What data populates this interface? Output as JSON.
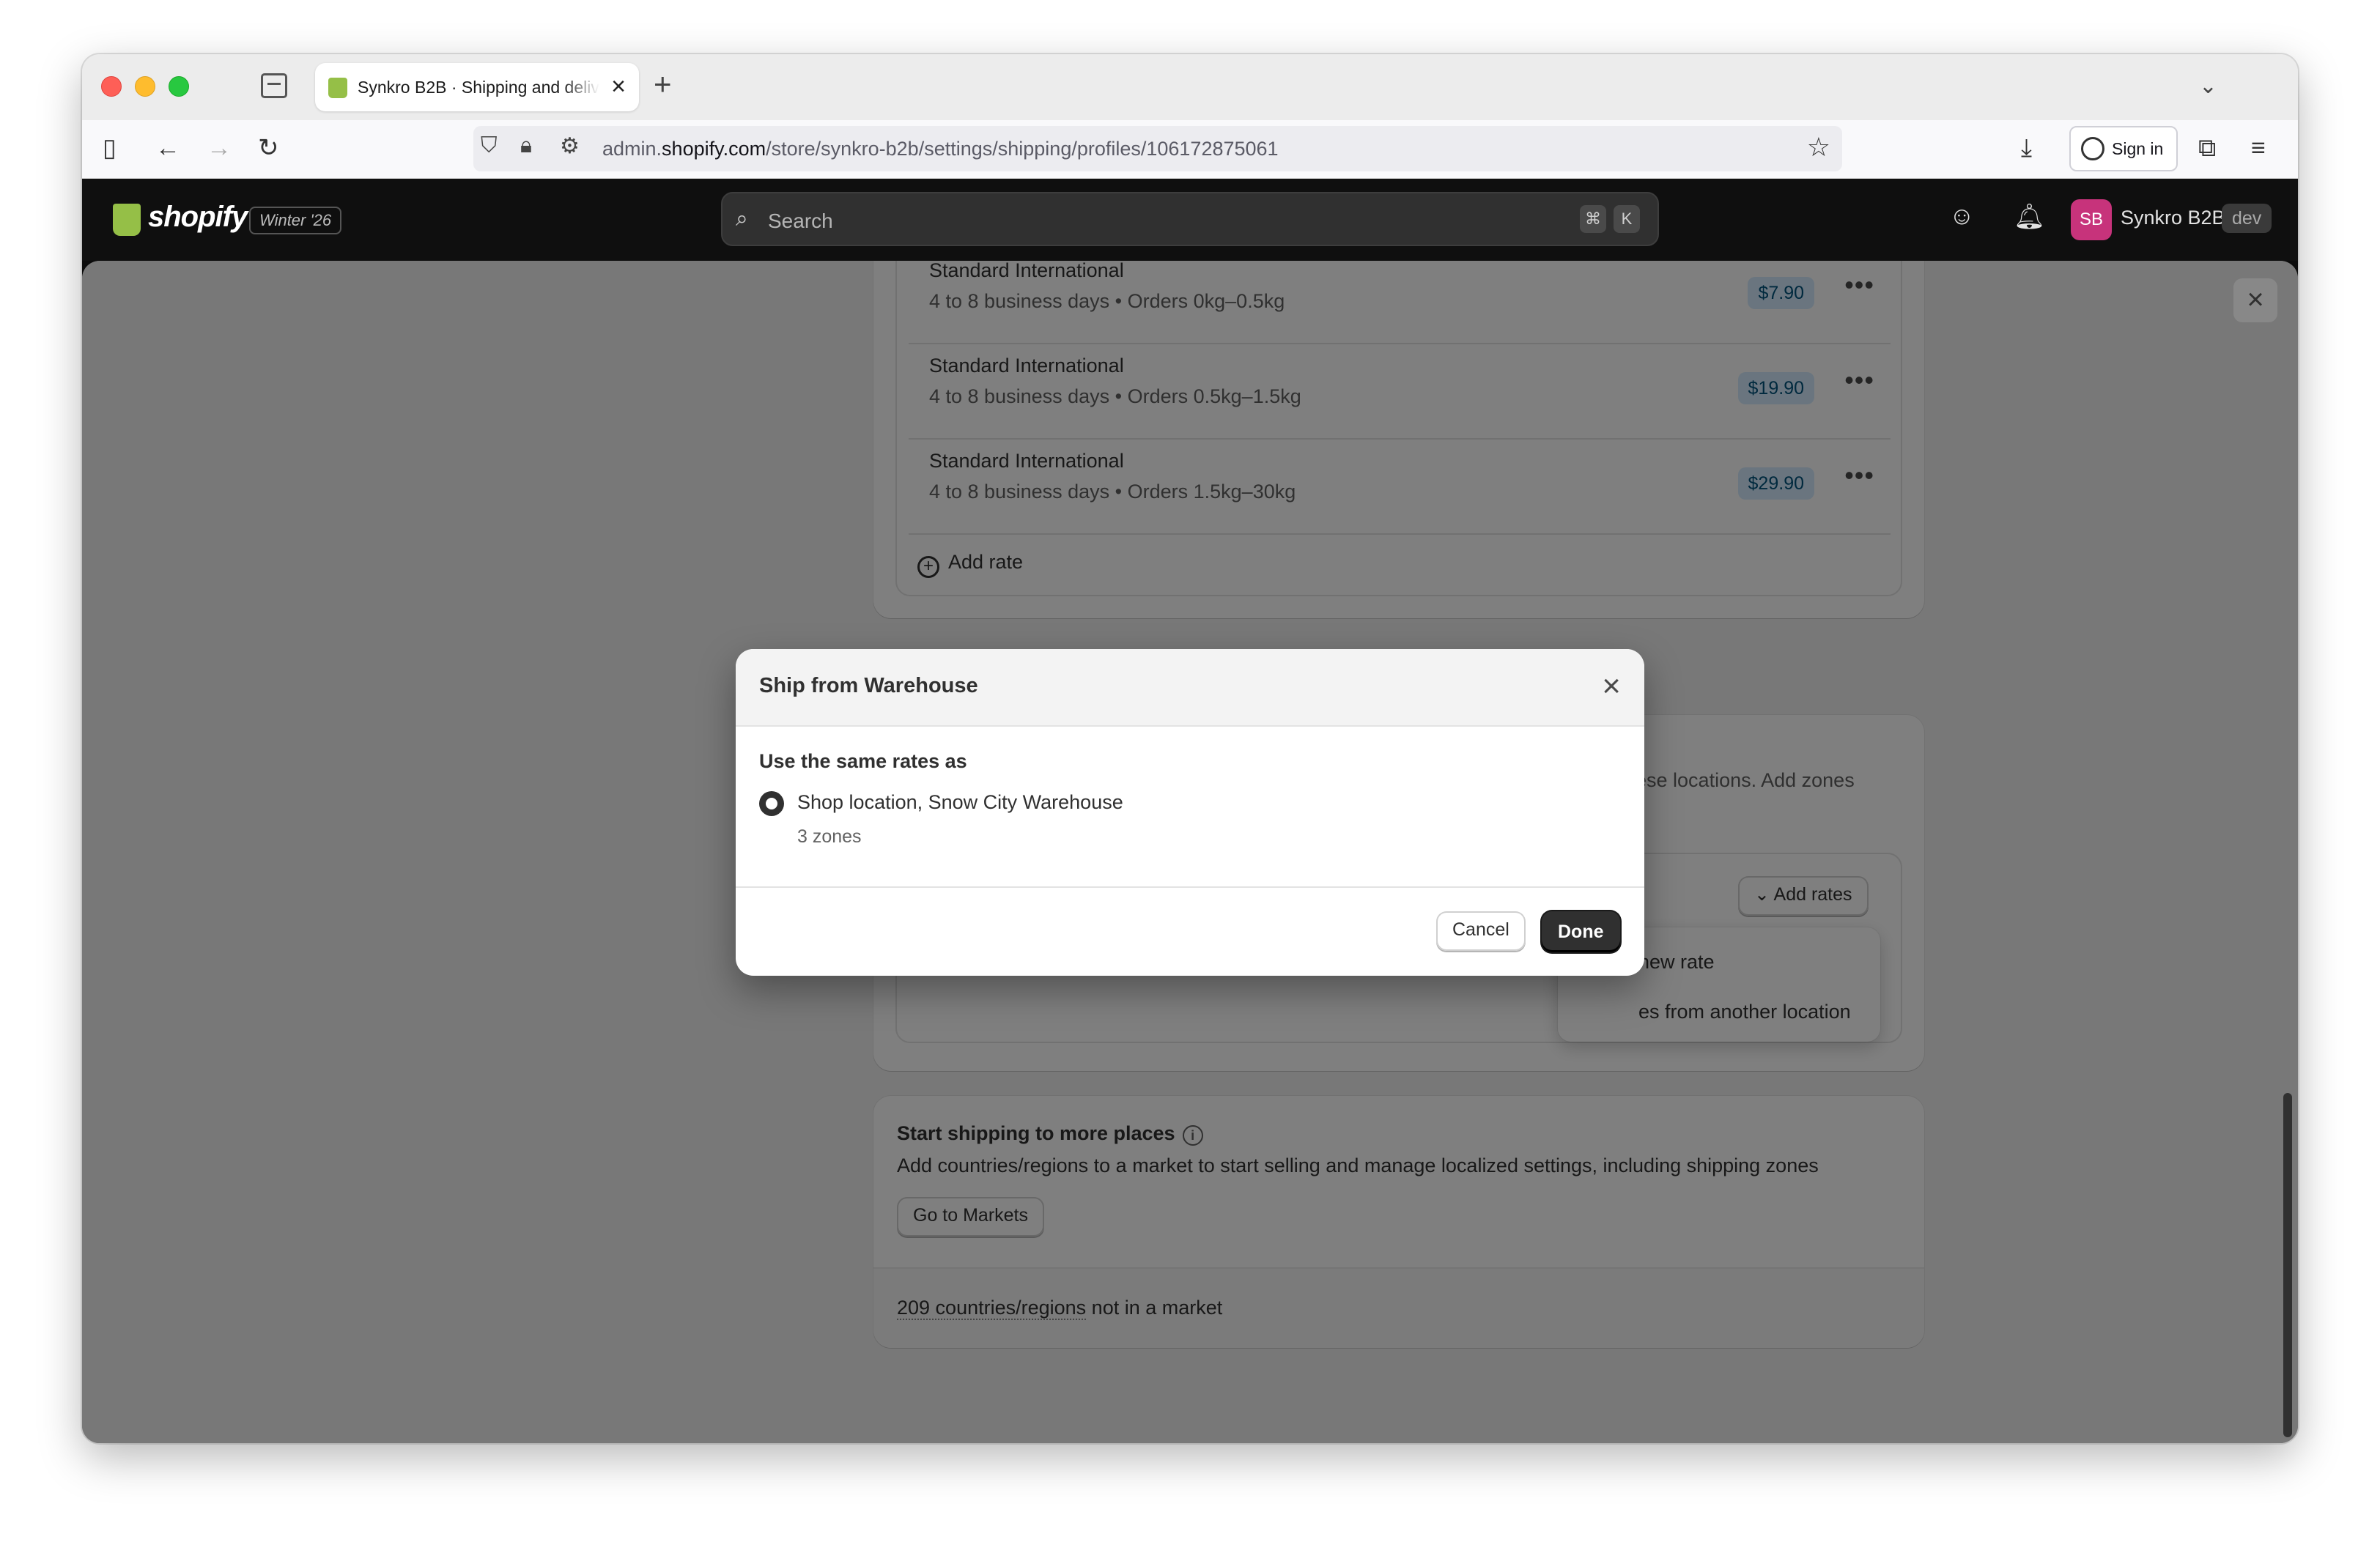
{
  "browser": {
    "tab_title": "Synkro B2B · Shipping and delivery",
    "url_prefix": "admin.",
    "url_domain": "shopify.com",
    "url_path": "/store/synkro-b2b/settings/shipping/profiles/106172875061",
    "sign_in_label": "Sign in"
  },
  "topbar": {
    "edition": "Winter '26",
    "search_placeholder": "Search",
    "shortcut_key1": "⌘",
    "shortcut_key2": "K",
    "avatar_initials": "SB",
    "store_name": "Synkro B2B",
    "dev_badge": "dev",
    "avatar_color": "#c7337b"
  },
  "rates": [
    {
      "name": "Standard International",
      "desc": "4 to 8 business days • Orders 0kg–0.5kg",
      "price": "$7.90"
    },
    {
      "name": "Standard International",
      "desc": "4 to 8 business days • Orders 0.5kg–1.5kg",
      "price": "$19.90"
    },
    {
      "name": "Standard International",
      "desc": "4 to 8 business days • Orders 1.5kg–30kg",
      "price": "$29.90"
    }
  ],
  "add_rate_label": "Add rate",
  "warehouse_card": {
    "partial_text": "ese locations. Add zones",
    "add_rates_label": "Add rates",
    "menu_items": [
      "new rate",
      "es from another location"
    ]
  },
  "markets_card": {
    "title": "Start shipping to more places",
    "description": "Add countries/regions to a market to start selling and manage localized settings, including shipping zones",
    "button_label": "Go to Markets",
    "footer_count": "209 countries/regions",
    "footer_suffix": " not in a market"
  },
  "modal": {
    "title": "Ship from Warehouse",
    "label": "Use the same rates as",
    "option_label": "Shop location, Snow City Warehouse",
    "option_help": "3 zones",
    "cancel_label": "Cancel",
    "done_label": "Done"
  }
}
